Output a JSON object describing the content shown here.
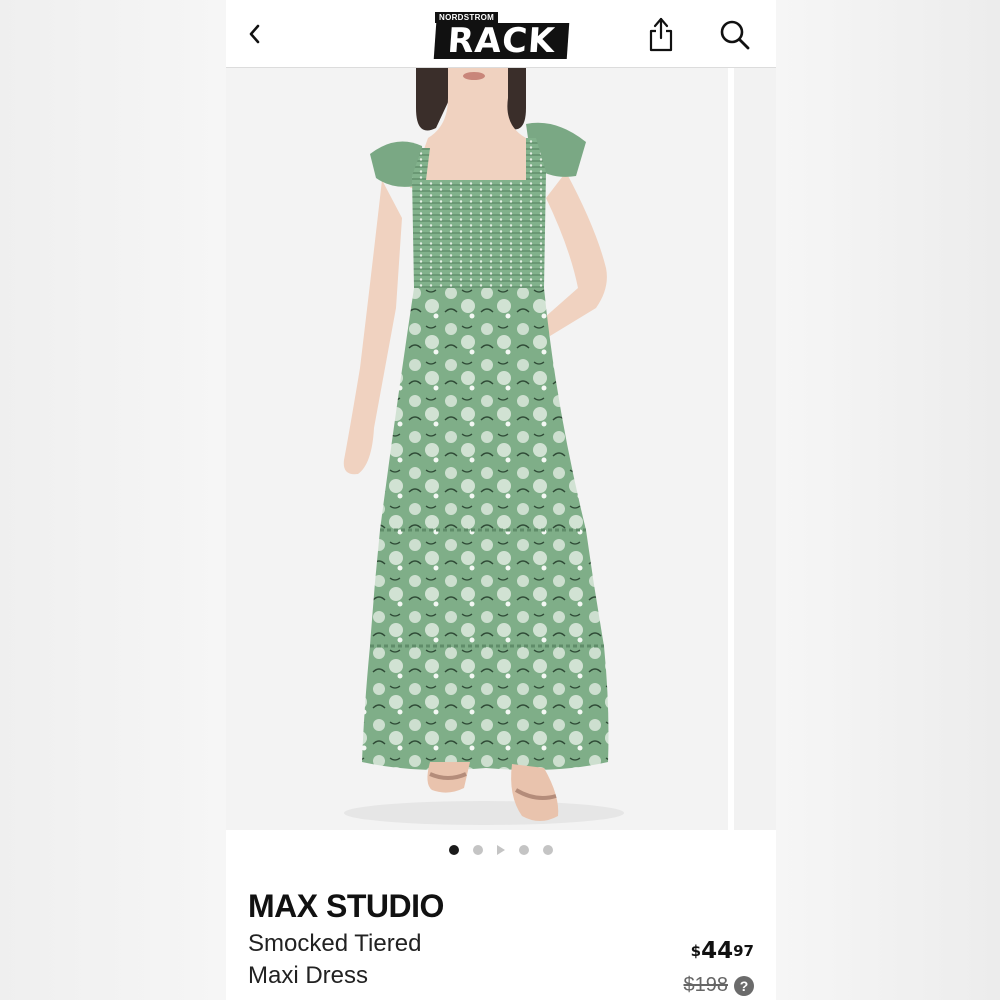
{
  "header": {
    "logo_top": "NORDSTROM",
    "logo_main": "RACK",
    "back_icon": "chevron-left-icon",
    "share_icon": "share-icon",
    "search_icon": "search-icon"
  },
  "gallery": {
    "current_index": 1,
    "total_items": 5,
    "has_video_indicator": true,
    "dress_color": "#7fb08a"
  },
  "product": {
    "brand": "MAX STUDIO",
    "name_line1": "Smocked Tiered",
    "name_line2": "Maxi Dress",
    "price_currency": "$",
    "price_whole": "44",
    "price_cents": "97",
    "compare_price": "$198",
    "help_icon_text": "?"
  }
}
